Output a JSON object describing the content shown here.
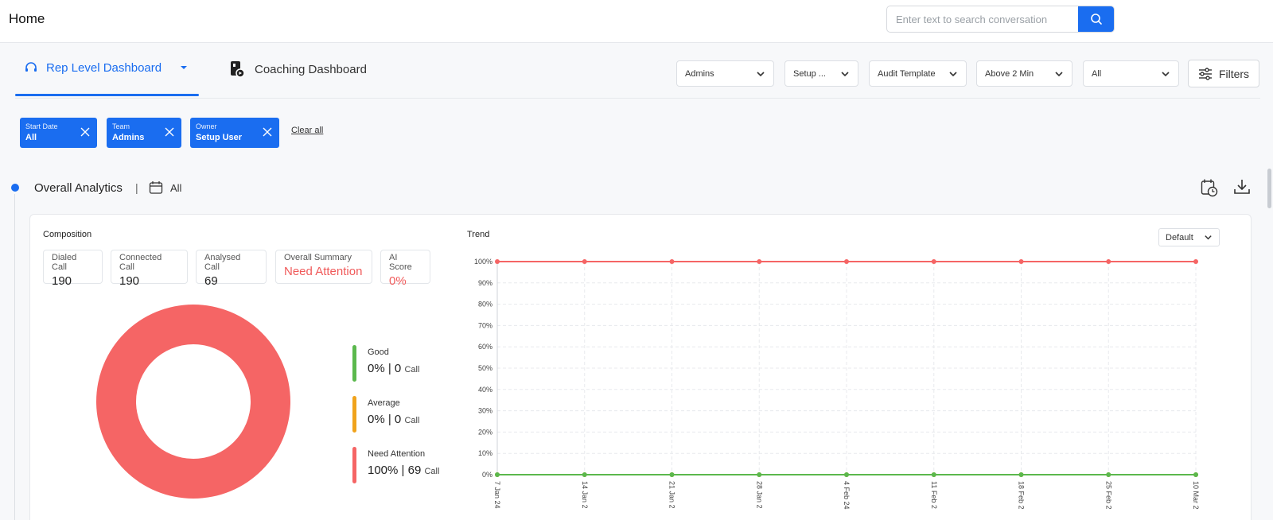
{
  "header": {
    "title": "Home",
    "search_placeholder": "Enter text to search conversation"
  },
  "tabs": [
    {
      "label": "Rep Level Dashboard",
      "active": true
    },
    {
      "label": "Coaching Dashboard",
      "active": false
    }
  ],
  "filters": {
    "selects": [
      "Admins",
      "Setup ...",
      "Audit Template",
      "Above 2 Min",
      "All"
    ],
    "button_label": "Filters"
  },
  "chips": [
    {
      "label": "Start Date",
      "value": "All"
    },
    {
      "label": "Team",
      "value": "Admins"
    },
    {
      "label": "Owner",
      "value": "Setup User"
    }
  ],
  "clear_all": "Clear all",
  "section": {
    "title": "Overall Analytics",
    "separator": "|",
    "date_range": "All"
  },
  "composition": {
    "title": "Composition",
    "stats": [
      {
        "label": "Dialed Call",
        "value": "190"
      },
      {
        "label": "Connected Call",
        "value": "190"
      },
      {
        "label": "Analysed Call",
        "value": "69"
      },
      {
        "label": "Overall Summary",
        "value": "Need Attention"
      },
      {
        "label": "AI Score",
        "value": "0%"
      }
    ],
    "legend": [
      {
        "name": "Good",
        "value": "0% | 0",
        "unit": "Call",
        "color": "#5bb84d"
      },
      {
        "name": "Average",
        "value": "0% | 0",
        "unit": "Call",
        "color": "#f0a31c"
      },
      {
        "name": "Need Attention",
        "value": "100% | 69",
        "unit": "Call",
        "color": "#f56565"
      }
    ]
  },
  "trend": {
    "title": "Trend",
    "select_value": "Default"
  },
  "colors": {
    "accent": "#1a6df0",
    "alert": "#f56565",
    "good": "#5bb84d",
    "average": "#f0a31c"
  },
  "chart_data": [
    {
      "type": "pie",
      "donut": true,
      "categories": [
        "Good",
        "Average",
        "Need Attention"
      ],
      "values": [
        0,
        0,
        100
      ],
      "colors": [
        "#5bb84d",
        "#f0a31c",
        "#f56565"
      ]
    },
    {
      "type": "line",
      "title": "Trend",
      "x": [
        "7 Jan 24",
        "14 Jan 2",
        "21 Jan 2",
        "28 Jan 2",
        "4 Feb 24",
        "11 Feb 2",
        "18 Feb 2",
        "25 Feb 2",
        "10 Mar 2"
      ],
      "yticks": [
        "0%",
        "10%",
        "20%",
        "30%",
        "40%",
        "50%",
        "60%",
        "70%",
        "80%",
        "90%",
        "100%"
      ],
      "ylim": [
        0,
        100
      ],
      "grid": true,
      "series": [
        {
          "values": [
            100,
            100,
            100,
            100,
            100,
            100,
            100,
            100,
            100
          ],
          "color": "#f56565"
        },
        {
          "values": [
            0,
            0,
            0,
            0,
            0,
            0,
            0,
            0,
            0
          ],
          "color": "#5bb84d"
        },
        {
          "values": [
            0,
            0,
            0,
            0,
            0,
            0,
            0,
            0,
            0
          ],
          "color": "#f0a31c"
        }
      ]
    }
  ]
}
